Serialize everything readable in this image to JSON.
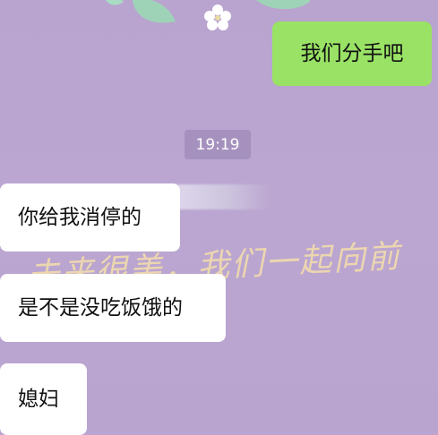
{
  "chat": {
    "timestamp": "19:19",
    "messages": [
      {
        "side": "right",
        "text": "我们分手吧"
      },
      {
        "side": "left",
        "text": "你给我消停的"
      },
      {
        "side": "left",
        "text": "是不是没吃饭饿的"
      },
      {
        "side": "left",
        "text": "媳妇"
      }
    ]
  },
  "background": {
    "watermark_text": "未来很美，我们一起向前",
    "color": "#bba5d0",
    "decor": [
      "leaf-icon",
      "flower-icon"
    ]
  },
  "colors": {
    "outgoing_bubble": "#99e265",
    "incoming_bubble": "#ffffff",
    "timestamp_pill": "#9f8bb5"
  }
}
